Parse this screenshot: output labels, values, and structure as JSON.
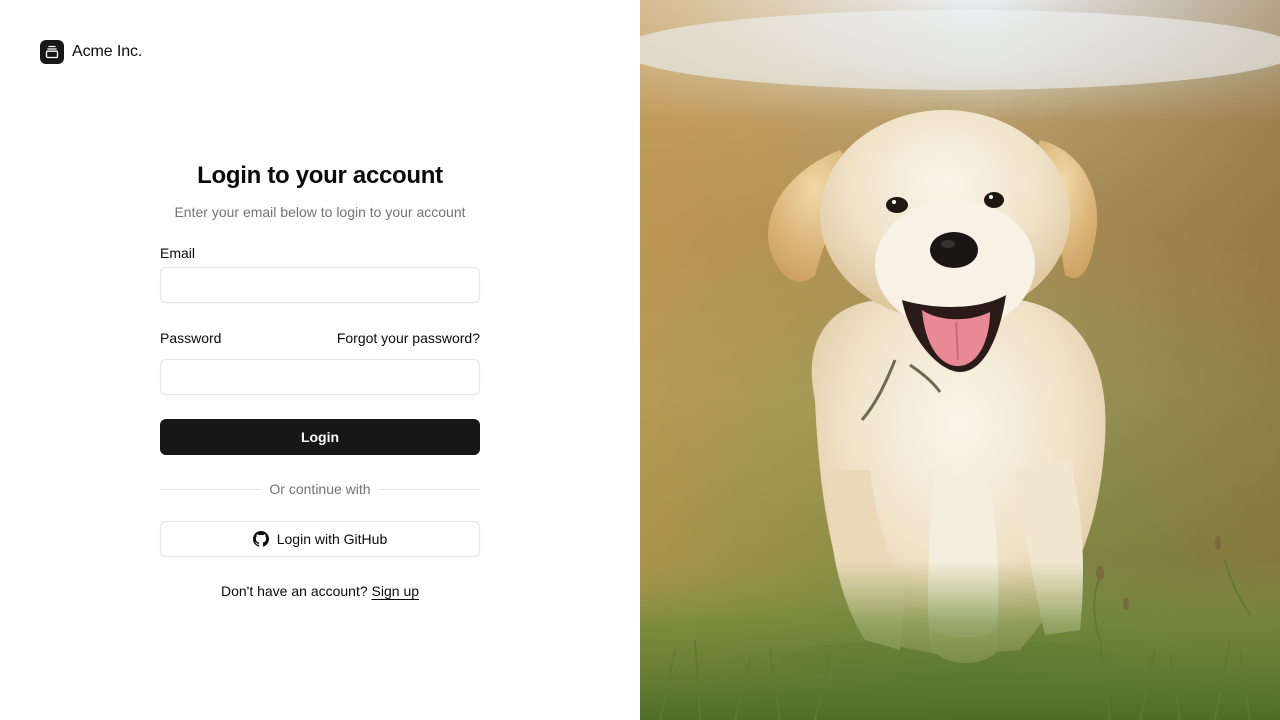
{
  "brand": {
    "name": "Acme Inc.",
    "logo_icon": "gallery-stack-icon"
  },
  "form": {
    "title": "Login to your account",
    "subtitle": "Enter your email below to login to your account",
    "email_label": "Email",
    "email_value": "",
    "password_label": "Password",
    "password_value": "",
    "forgot_link": "Forgot your password?",
    "login_button": "Login",
    "divider_text": "Or continue with",
    "github_button": "Login with GitHub",
    "github_icon": "github-icon",
    "signup_prompt": "Don't have an account?",
    "signup_link": "Sign up"
  },
  "hero_image": {
    "subject": "golden-retriever-puppy"
  },
  "colors": {
    "primary_button": "#171717",
    "muted_text": "#737373",
    "border": "#e5e5e5"
  }
}
